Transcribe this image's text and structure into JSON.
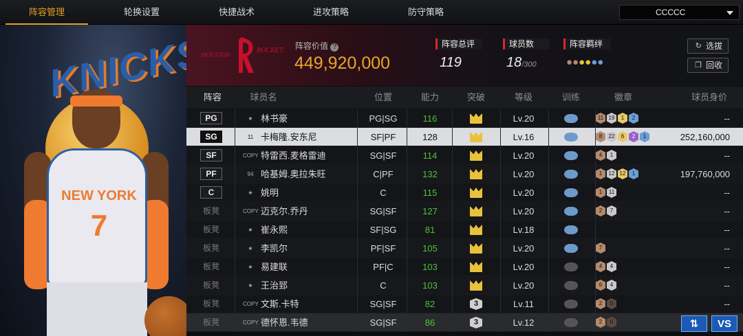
{
  "tabs": [
    "阵容管理",
    "轮换设置",
    "快捷战术",
    "进攻策略",
    "防守策略"
  ],
  "active_tab": "阵容管理",
  "dropdown": {
    "value": "CCCCC"
  },
  "team": {
    "value_label": "阵容价值",
    "value": "449,920,000",
    "rating_label": "阵容总评",
    "rating": "119",
    "players_label": "球员数",
    "players": "18",
    "players_max": "/300",
    "bonds_label": "阵容羁绊",
    "btn_select": "选拔",
    "btn_recycle": "回收"
  },
  "columns": [
    "阵容",
    "球员名",
    "位置",
    "能力",
    "突破",
    "等级",
    "训练",
    "徽章",
    "球员身价"
  ],
  "rows": [
    {
      "slot": "PG",
      "tag": "★",
      "name": "林书豪",
      "pos": "PG|SG",
      "ability": "116",
      "green": true,
      "break": "crown",
      "level": "Lv.20",
      "train": "blue",
      "badges": [
        [
          "b",
          "11"
        ],
        [
          "s",
          "19"
        ],
        [
          "g",
          "1"
        ],
        [
          "bl",
          "2"
        ]
      ],
      "value": "--"
    },
    {
      "slot": "SG",
      "tag": "11",
      "name": "卡梅隆.安东尼",
      "pos": "SF|PF",
      "ability": "128",
      "green": false,
      "break": "crown",
      "level": "Lv.16",
      "train": "blue",
      "badges": [
        [
          "b",
          "8"
        ],
        [
          "s",
          "22"
        ],
        [
          "g",
          "6"
        ],
        [
          "p",
          "2"
        ],
        [
          "bl",
          "1"
        ]
      ],
      "value": "252,160,000",
      "selected": true
    },
    {
      "slot": "SF",
      "tag": "COPY",
      "name": "特雷西.麦格雷迪",
      "pos": "SG|SF",
      "ability": "114",
      "green": true,
      "break": "crown",
      "level": "Lv.20",
      "train": "blue",
      "badges": [
        [
          "b",
          "4"
        ],
        [
          "s",
          "1"
        ]
      ],
      "value": "--"
    },
    {
      "slot": "PF",
      "tag": "94",
      "name": "哈基姆.奥拉朱旺",
      "pos": "C|PF",
      "ability": "132",
      "green": true,
      "break": "crown",
      "level": "Lv.20",
      "train": "blue",
      "badges": [
        [
          "b",
          "1"
        ],
        [
          "s",
          "12"
        ],
        [
          "g",
          "12"
        ],
        [
          "bl",
          "1"
        ]
      ],
      "value": "197,760,000"
    },
    {
      "slot": "C",
      "tag": "★",
      "name": "姚明",
      "pos": "C",
      "ability": "115",
      "green": true,
      "break": "crown",
      "level": "Lv.20",
      "train": "blue",
      "badges": [
        [
          "b",
          "1"
        ],
        [
          "s",
          "11"
        ]
      ],
      "value": "--"
    },
    {
      "slot": "板凳",
      "tag": "COPY",
      "name": "迈克尔.乔丹",
      "pos": "SG|SF",
      "ability": "127",
      "green": true,
      "break": "crown",
      "level": "Lv.20",
      "train": "blue",
      "badges": [
        [
          "b",
          "2"
        ],
        [
          "s",
          "7"
        ]
      ],
      "value": "--",
      "bench": true
    },
    {
      "slot": "板凳",
      "tag": "★",
      "name": "崔永熙",
      "pos": "SF|SG",
      "ability": "81",
      "green": true,
      "break": "crown",
      "level": "Lv.18",
      "train": "blue",
      "badges": [],
      "value": "--",
      "bench": true
    },
    {
      "slot": "板凳",
      "tag": "★",
      "name": "李凯尔",
      "pos": "PF|SF",
      "ability": "105",
      "green": true,
      "break": "crown",
      "level": "Lv.20",
      "train": "blue",
      "badges": [
        [
          "b",
          "7"
        ]
      ],
      "value": "--",
      "bench": true
    },
    {
      "slot": "板凳",
      "tag": "★",
      "name": "易建联",
      "pos": "PF|C",
      "ability": "103",
      "green": true,
      "break": "crown",
      "level": "Lv.20",
      "train": "gray",
      "badges": [
        [
          "b",
          "4"
        ],
        [
          "s",
          "4"
        ]
      ],
      "value": "--",
      "bench": true
    },
    {
      "slot": "板凳",
      "tag": "★",
      "name": "王治郅",
      "pos": "C",
      "ability": "103",
      "green": true,
      "break": "crown",
      "level": "Lv.20",
      "train": "gray",
      "badges": [
        [
          "b",
          "6"
        ],
        [
          "s",
          "4"
        ]
      ],
      "value": "--",
      "bench": true
    },
    {
      "slot": "板凳",
      "tag": "COPY",
      "name": "文斯.卡特",
      "pos": "SG|SF",
      "ability": "82",
      "green": true,
      "break": "3",
      "level": "Lv.11",
      "train": "gray",
      "badges": [
        [
          "b",
          "2"
        ],
        [
          "dk",
          "0"
        ]
      ],
      "value": "--",
      "bench": true
    },
    {
      "slot": "板凳",
      "tag": "COPY",
      "name": "德怀恩.韦德",
      "pos": "SG|SF",
      "ability": "86",
      "green": true,
      "break": "3",
      "level": "Lv.12",
      "train": "gray",
      "badges": [
        [
          "b",
          "2"
        ],
        [
          "dk",
          "0"
        ]
      ],
      "value": "--",
      "bench": true,
      "dim": true
    }
  ],
  "corner_buttons": {
    "swap": "⇅",
    "vs": "VS"
  }
}
